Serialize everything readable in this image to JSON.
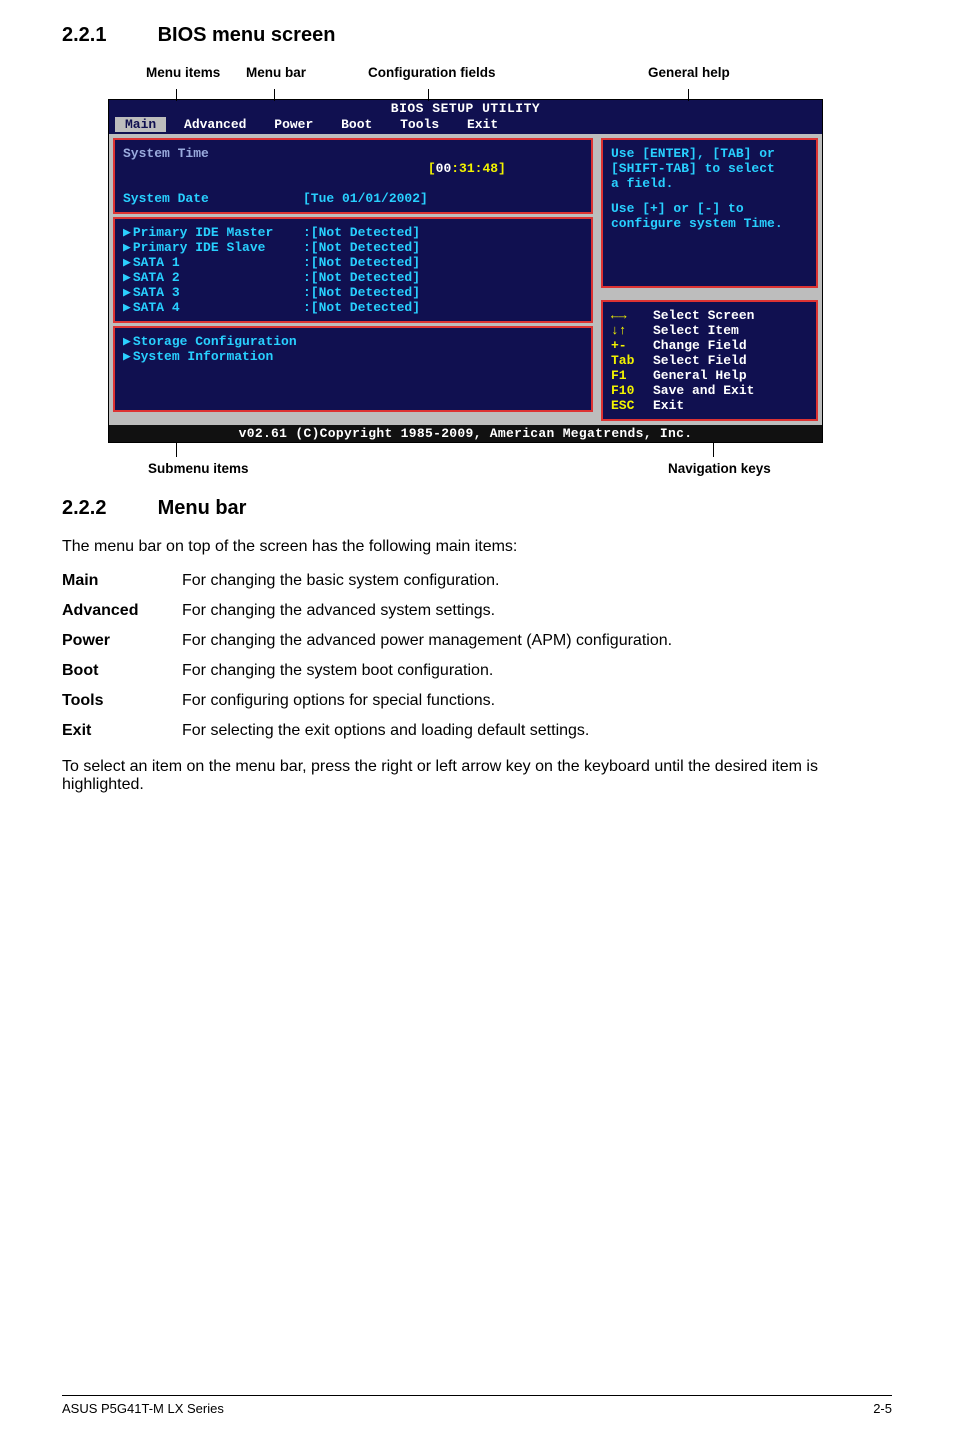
{
  "sections": {
    "s221": {
      "num": "2.2.1",
      "title": "BIOS menu screen"
    },
    "s222": {
      "num": "2.2.2",
      "title": "Menu bar"
    }
  },
  "callouts": {
    "menu_items": "Menu items",
    "menu_bar": "Menu bar",
    "config_fields": "Configuration fields",
    "general_help": "General help",
    "submenu_items": "Submenu items",
    "nav_keys": "Navigation keys"
  },
  "bios": {
    "title": "BIOS SETUP UTILITY",
    "tabs": {
      "main": "Main",
      "advanced": "Advanced",
      "power": "Power",
      "boot": "Boot",
      "tools": "Tools",
      "exit": "Exit"
    },
    "rows": {
      "sys_time_l": "System Time",
      "sys_time_r_a": "[",
      "sys_time_r_b": "00",
      "sys_time_r_c": ":31:48]",
      "sys_date_l": "System Date",
      "sys_date_r": "[Tue 01/01/2002]",
      "pidem_l": "Primary IDE Master",
      "pides_l": "Primary IDE Slave",
      "sata1": "SATA 1",
      "sata2": "SATA 2",
      "sata3": "SATA 3",
      "sata4": "SATA 4",
      "nd": ":[Not Detected]",
      "storage": "Storage Configuration",
      "sysinfo": "System Information"
    },
    "help": {
      "l1": "Use [ENTER], [TAB] or",
      "l2": "[SHIFT-TAB] to select",
      "l3": "a field.",
      "l4": "Use [+] or [-] to",
      "l5": "configure system Time."
    },
    "nav": {
      "k1": "←→",
      "v1": "Select Screen",
      "k2": "↓↑",
      "v2": "Select Item",
      "k3": "+-",
      "v3": "Change Field",
      "k4": "Tab",
      "v4": "Select Field",
      "k5": "F1",
      "v5": "General Help",
      "k6": "F10",
      "v6": "Save and Exit",
      "k7": "ESC",
      "v7": "Exit"
    },
    "footer": "v02.61 (C)Copyright 1985-2009, American Megatrends, Inc."
  },
  "s222_intro": "The menu bar on top of the screen has the following main items:",
  "desc": {
    "main_k": "Main",
    "main_v": "For changing the basic system configuration.",
    "adv_k": "Advanced",
    "adv_v": "For changing the advanced system settings.",
    "pow_k": "Power",
    "pow_v": "For changing the advanced power management (APM) configuration.",
    "boot_k": "Boot",
    "boot_v": "For changing the system boot configuration.",
    "tools_k": "Tools",
    "tools_v": "For configuring options for special functions.",
    "exit_k": "Exit",
    "exit_v": "For selecting the exit options and loading default settings."
  },
  "s222_outro": "To select an item on the menu bar, press the right or left arrow key on the keyboard until the desired item is highlighted.",
  "footer": {
    "left": "ASUS P5G41T-M LX Series",
    "right": "2-5"
  }
}
